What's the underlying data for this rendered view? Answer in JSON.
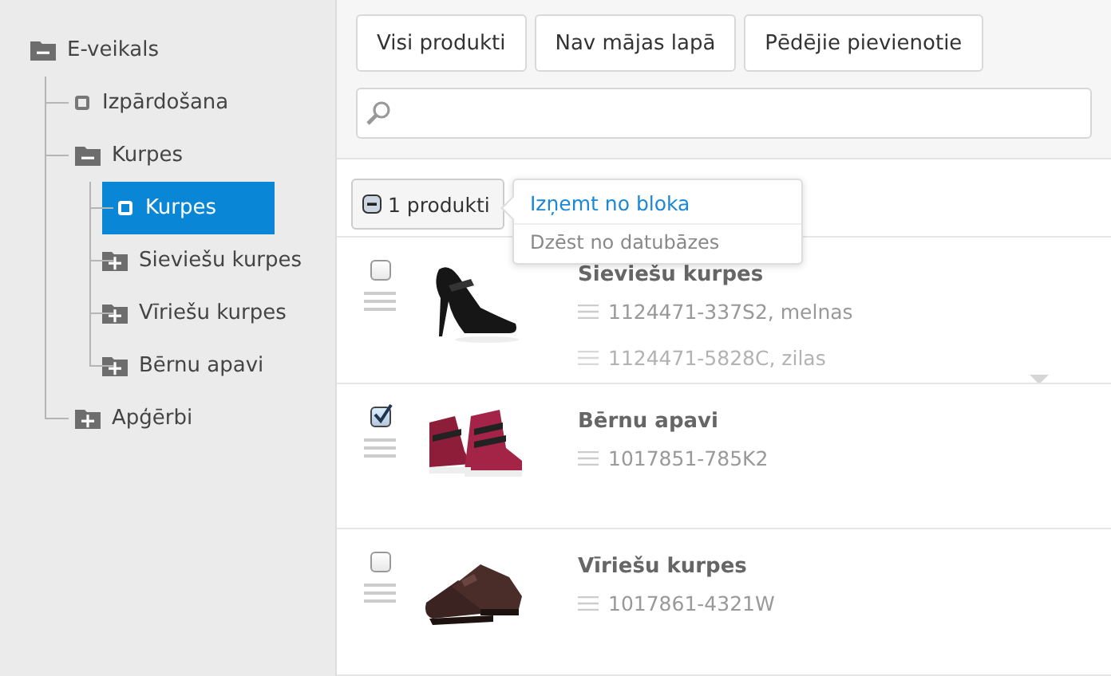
{
  "tree": [
    {
      "label": "E-veikals",
      "kind": "folder",
      "expanded": true,
      "selected": false,
      "children": [
        {
          "label": "Izpārdošana",
          "kind": "leaf",
          "selected": false
        },
        {
          "label": "Kurpes",
          "kind": "folder",
          "expanded": true,
          "selected": false,
          "children": [
            {
              "label": "Kurpes",
              "kind": "leaf",
              "selected": true
            },
            {
              "label": "Sieviešu kurpes",
              "kind": "folder",
              "expanded": false,
              "selected": false
            },
            {
              "label": "Vīriešu kurpes",
              "kind": "folder",
              "expanded": false,
              "selected": false
            },
            {
              "label": "Bērnu apavi",
              "kind": "folder",
              "expanded": false,
              "selected": false
            }
          ]
        },
        {
          "label": "Apģērbi",
          "kind": "folder",
          "expanded": false,
          "selected": false
        }
      ]
    }
  ],
  "filters": [
    {
      "label": "Visi produkti"
    },
    {
      "label": "Nav mājas lapā"
    },
    {
      "label": "Pēdējie pievienotie"
    }
  ],
  "bulk": {
    "label": "1 produkti",
    "menu": [
      {
        "label": "Izņemt no bloka",
        "kind": "primary"
      },
      {
        "label": "Dzēst no datubāzes",
        "kind": "normal"
      }
    ]
  },
  "products": [
    {
      "name": "Sieviešu kurpes",
      "checked": false,
      "expandable": true,
      "variants": [
        "1124471-337S2, melnas",
        "1124471-5828C, zilas"
      ]
    },
    {
      "name": "Bērnu apavi",
      "checked": true,
      "expandable": false,
      "variants": [
        "1017851-785K2"
      ]
    },
    {
      "name": "Vīriešu kurpes",
      "checked": false,
      "expandable": false,
      "variants": [
        "1017861-4321W"
      ]
    }
  ]
}
